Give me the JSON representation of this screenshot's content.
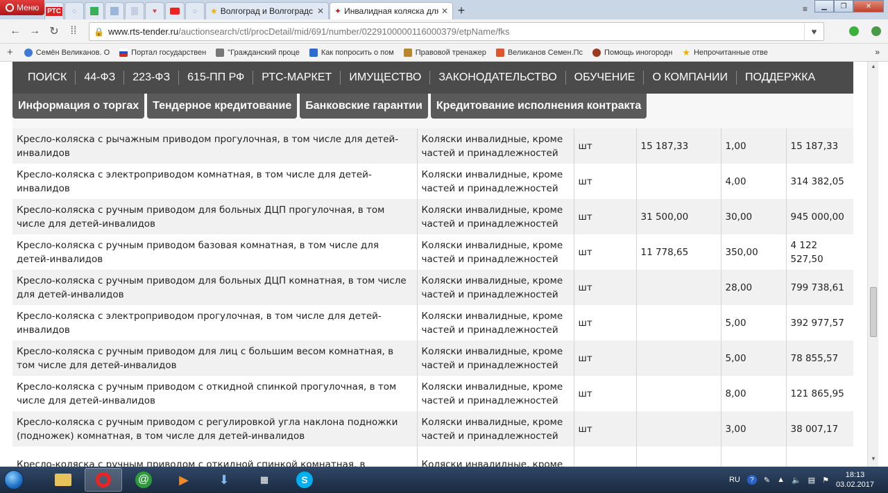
{
  "browser": {
    "menu_label": "Меню",
    "mini_tabs": [
      "РТС",
      "",
      "",
      "",
      "",
      "",
      ""
    ],
    "tabs": [
      {
        "title": "Волгоград и Волгоградс",
        "active": false
      },
      {
        "title": "Инвалидная коляска для",
        "active": true
      }
    ],
    "url_host": "www.rts-tender.ru",
    "url_path": "/auctionsearch/ctl/procDetail/mid/691/number/0229100000116000379/etpName/fks",
    "bookmarks": [
      {
        "label": "Семён Великанов. О",
        "color": "#3d7ad6"
      },
      {
        "label": "Портал государствен",
        "color": "#d33"
      },
      {
        "label": "\"Гражданский проце",
        "color": "#777"
      },
      {
        "label": "Как попросить о пом",
        "color": "#2b6cd1"
      },
      {
        "label": "Правовой тренажер",
        "color": "#b8862b"
      },
      {
        "label": "Великанов Семен.Пс",
        "color": "#e0552e"
      },
      {
        "label": "Помощь иногородн",
        "color": "#9b3b1f"
      },
      {
        "label": "Непрочитанные отве",
        "color": "#f0b000"
      }
    ]
  },
  "site": {
    "topnav": [
      "ПОИСК",
      "44-ФЗ",
      "223-ФЗ",
      "615-ПП РФ",
      "РТС-МАРКЕТ",
      "ИМУЩЕСТВО",
      "ЗАКОНОДАТЕЛЬСТВО",
      "ОБУЧЕНИЕ",
      "О КОМПАНИИ",
      "ПОДДЕРЖКА"
    ],
    "subnav": [
      "Информация о торгах",
      "Тендерное кредитование",
      "Банковские гарантии",
      "Кредитование исполнения контракта"
    ]
  },
  "table": {
    "rows": [
      {
        "name": "Кресло-коляска с рычажным приводом прогулочная, в том числе для детей-инвалидов",
        "okpd": "Коляски инвалидные, кроме частей и принадлежностей",
        "unit": "шт",
        "price": "15 187,33",
        "qty": "1,00",
        "sum": "15 187,33"
      },
      {
        "name": "Кресло-коляска с электроприводом комнатная, в том числе для детей-инвалидов",
        "okpd": "Коляски инвалидные, кроме частей и принадлежностей",
        "unit": "шт",
        "price": "",
        "qty": "4,00",
        "sum": "314 382,05"
      },
      {
        "name": "Кресло-коляска с ручным приводом для больных ДЦП прогулочная, в том числе для детей-инвалидов",
        "okpd": "Коляски инвалидные, кроме частей и принадлежностей",
        "unit": "шт",
        "price": "31 500,00",
        "qty": "30,00",
        "sum": "945 000,00"
      },
      {
        "name": "Кресло-коляска с ручным приводом базовая комнатная, в том числе для детей-инвалидов",
        "okpd": "Коляски инвалидные, кроме частей и принадлежностей",
        "unit": "шт",
        "price": "11 778,65",
        "qty": "350,00",
        "sum": "4 122 527,50"
      },
      {
        "name": "Кресло-коляска с ручным приводом для больных ДЦП комнатная, в том числе для детей-инвалидов",
        "okpd": "Коляски инвалидные, кроме частей и принадлежностей",
        "unit": "шт",
        "price": "",
        "qty": "28,00",
        "sum": "799 738,61"
      },
      {
        "name": "Кресло-коляска с электроприводом прогулочная, в том числе для детей-инвалидов",
        "okpd": "Коляски инвалидные, кроме частей и принадлежностей",
        "unit": "шт",
        "price": "",
        "qty": "5,00",
        "sum": "392 977,57"
      },
      {
        "name": "Кресло-коляска с ручным приводом для лиц с большим весом комнатная, в том числе для детей-инвалидов",
        "okpd": "Коляски инвалидные, кроме частей и принадлежностей",
        "unit": "шт",
        "price": "",
        "qty": "5,00",
        "sum": "78 855,57"
      },
      {
        "name": "Кресло-коляска с ручным приводом с откидной спинкой прогулочная, в том числе для детей-инвалидов",
        "okpd": "Коляски инвалидные, кроме частей и принадлежностей",
        "unit": "шт",
        "price": "",
        "qty": "8,00",
        "sum": "121 865,95"
      },
      {
        "name": "Кресло-коляска с ручным приводом с регулировкой угла наклона подножки (подножек) комнатная, в том числе для детей-инвалидов",
        "okpd": "Коляски инвалидные, кроме частей и принадлежностей",
        "unit": "шт",
        "price": "",
        "qty": "3,00",
        "sum": "38 007,17"
      },
      {
        "name": "Кресло-коляска с ручным приводом с откидной спинкой комнатная, в",
        "okpd": "Коляски инвалидные, кроме",
        "unit": "",
        "price": "",
        "qty": "",
        "sum": ""
      }
    ]
  },
  "taskbar": {
    "lang": "RU",
    "time": "18:13",
    "date": "03.02.2017"
  }
}
